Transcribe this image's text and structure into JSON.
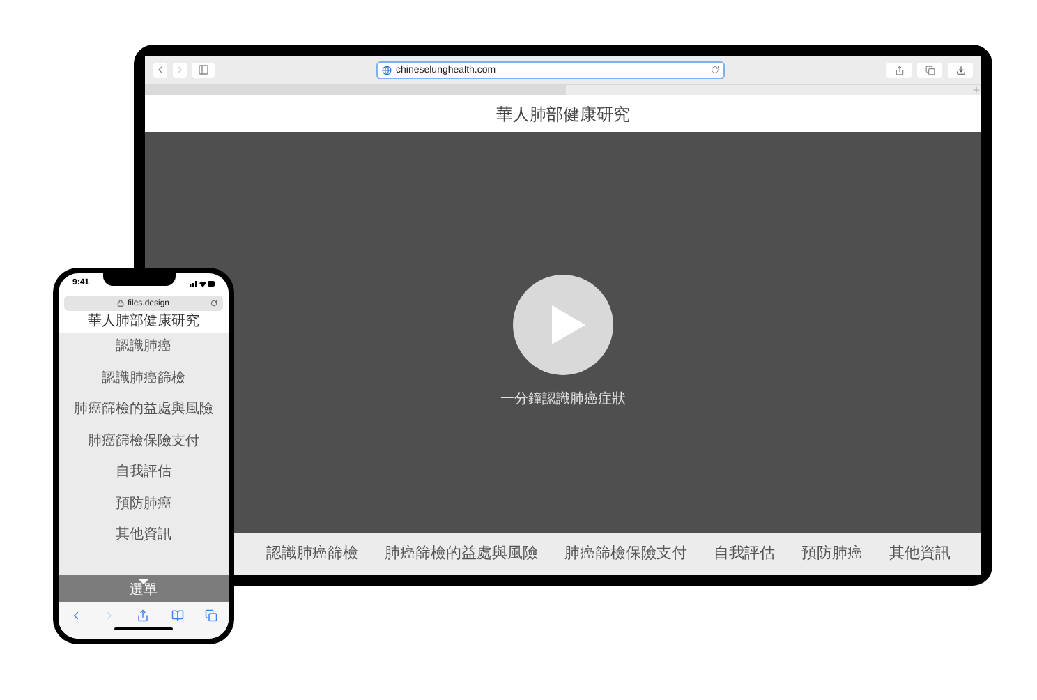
{
  "tablet": {
    "url": "chineselunghealth.com",
    "site_title": "華人肺部健康研究",
    "video": {
      "caption": "一分鐘認識肺癌症狀"
    },
    "nav": [
      "認識肺癌篩檢",
      "肺癌篩檢的益處與風險",
      "肺癌篩檢保險支付",
      "自我評估",
      "預防肺癌",
      "其他資訊"
    ]
  },
  "phone": {
    "time": "9:41",
    "url": "files.design",
    "site_title": "華人肺部健康研究",
    "menu": [
      "認識肺癌",
      "認識肺癌篩檢",
      "肺癌篩檢的益處與風險",
      "肺癌篩檢保險支付",
      "自我評估",
      "預防肺癌",
      "其他資訊"
    ],
    "menu_toggle": "選單",
    "toolbar": [
      {
        "kind": "back",
        "disabled": false
      },
      {
        "kind": "forward",
        "disabled": true
      },
      {
        "kind": "share",
        "disabled": false
      },
      {
        "kind": "bookmarks",
        "disabled": false
      },
      {
        "kind": "tabs",
        "disabled": false
      }
    ]
  }
}
